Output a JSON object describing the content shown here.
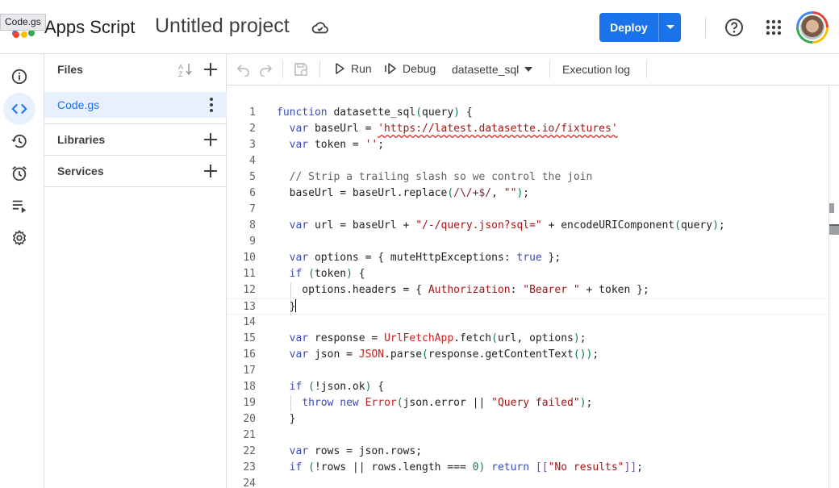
{
  "tooltip": "Code.gs",
  "header": {
    "app_name": "Apps Script",
    "project_title": "Untitled project",
    "deploy_label": "Deploy"
  },
  "rail": [
    "info-icon",
    "code-icon",
    "history-icon",
    "alarm-icon",
    "executions-icon",
    "settings-icon"
  ],
  "files_panel": {
    "files_label": "Files",
    "file_name": "Code.gs",
    "libraries_label": "Libraries",
    "services_label": "Services"
  },
  "toolbar": {
    "run_label": "Run",
    "debug_label": "Debug",
    "function_name": "datasette_sql",
    "execution_log_label": "Execution log"
  },
  "editor": {
    "current_line": 13,
    "lines": [
      {
        "n": "1",
        "code": "function datasette_sql(query) {"
      },
      {
        "n": "2",
        "code": "  var baseUrl = 'https://latest.datasette.io/fixtures'"
      },
      {
        "n": "3",
        "code": "  var token = '';"
      },
      {
        "n": "4",
        "code": ""
      },
      {
        "n": "5",
        "code": "  // Strip a trailing slash so we control the join"
      },
      {
        "n": "6",
        "code": "  baseUrl = baseUrl.replace(/\\/+$/, \"\");"
      },
      {
        "n": "7",
        "code": ""
      },
      {
        "n": "8",
        "code": "  var url = baseUrl + \"/-/query.json?sql=\" + encodeURIComponent(query);"
      },
      {
        "n": "9",
        "code": ""
      },
      {
        "n": "10",
        "code": "  var options = { muteHttpExceptions: true };"
      },
      {
        "n": "11",
        "code": "  if (token) {"
      },
      {
        "n": "12",
        "code": "    options.headers = { Authorization: \"Bearer \" + token };"
      },
      {
        "n": "13",
        "code": "  }"
      },
      {
        "n": "14",
        "code": ""
      },
      {
        "n": "15",
        "code": "  var response = UrlFetchApp.fetch(url, options);"
      },
      {
        "n": "16",
        "code": "  var json = JSON.parse(response.getContentText());"
      },
      {
        "n": "17",
        "code": ""
      },
      {
        "n": "18",
        "code": "  if (!json.ok) {"
      },
      {
        "n": "19",
        "code": "    throw new Error(json.error || \"Query failed\");"
      },
      {
        "n": "20",
        "code": "  }"
      },
      {
        "n": "21",
        "code": ""
      },
      {
        "n": "22",
        "code": "  var rows = json.rows;"
      },
      {
        "n": "23",
        "code": "  if (!rows || rows.length === 0) return [[\"No results\"]];"
      },
      {
        "n": "24",
        "code": ""
      }
    ]
  }
}
